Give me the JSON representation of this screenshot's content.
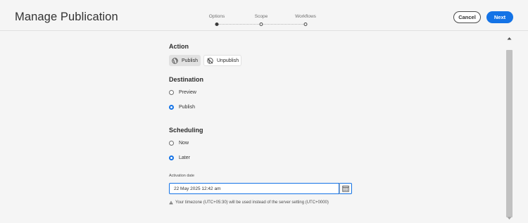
{
  "header": {
    "title": "Manage Publication",
    "cancel_label": "Cancel",
    "next_label": "Next",
    "accent_color": "#1473e6"
  },
  "stepper": {
    "steps": [
      {
        "label": "Options",
        "active": true
      },
      {
        "label": "Scope",
        "active": false
      },
      {
        "label": "Workflows",
        "active": false
      }
    ]
  },
  "action": {
    "title": "Action",
    "options": [
      {
        "label": "Publish",
        "icon": "globe-icon",
        "selected": true
      },
      {
        "label": "Unpublish",
        "icon": "globe-off-icon",
        "selected": false
      }
    ]
  },
  "destination": {
    "title": "Destination",
    "options": [
      {
        "label": "Preview",
        "checked": false
      },
      {
        "label": "Publish",
        "checked": true
      }
    ]
  },
  "scheduling": {
    "title": "Scheduling",
    "options": [
      {
        "label": "Now",
        "checked": false
      },
      {
        "label": "Later",
        "checked": true
      }
    ],
    "activation_label": "Activation date",
    "activation_value": "22 May 2025 12:42 am",
    "calendar_icon": "calendar-icon",
    "timezone_note": "Your timezone (UTC+05:30) will be used instead of the server setting (UTC+0000)",
    "alert_icon": "alert-icon"
  }
}
